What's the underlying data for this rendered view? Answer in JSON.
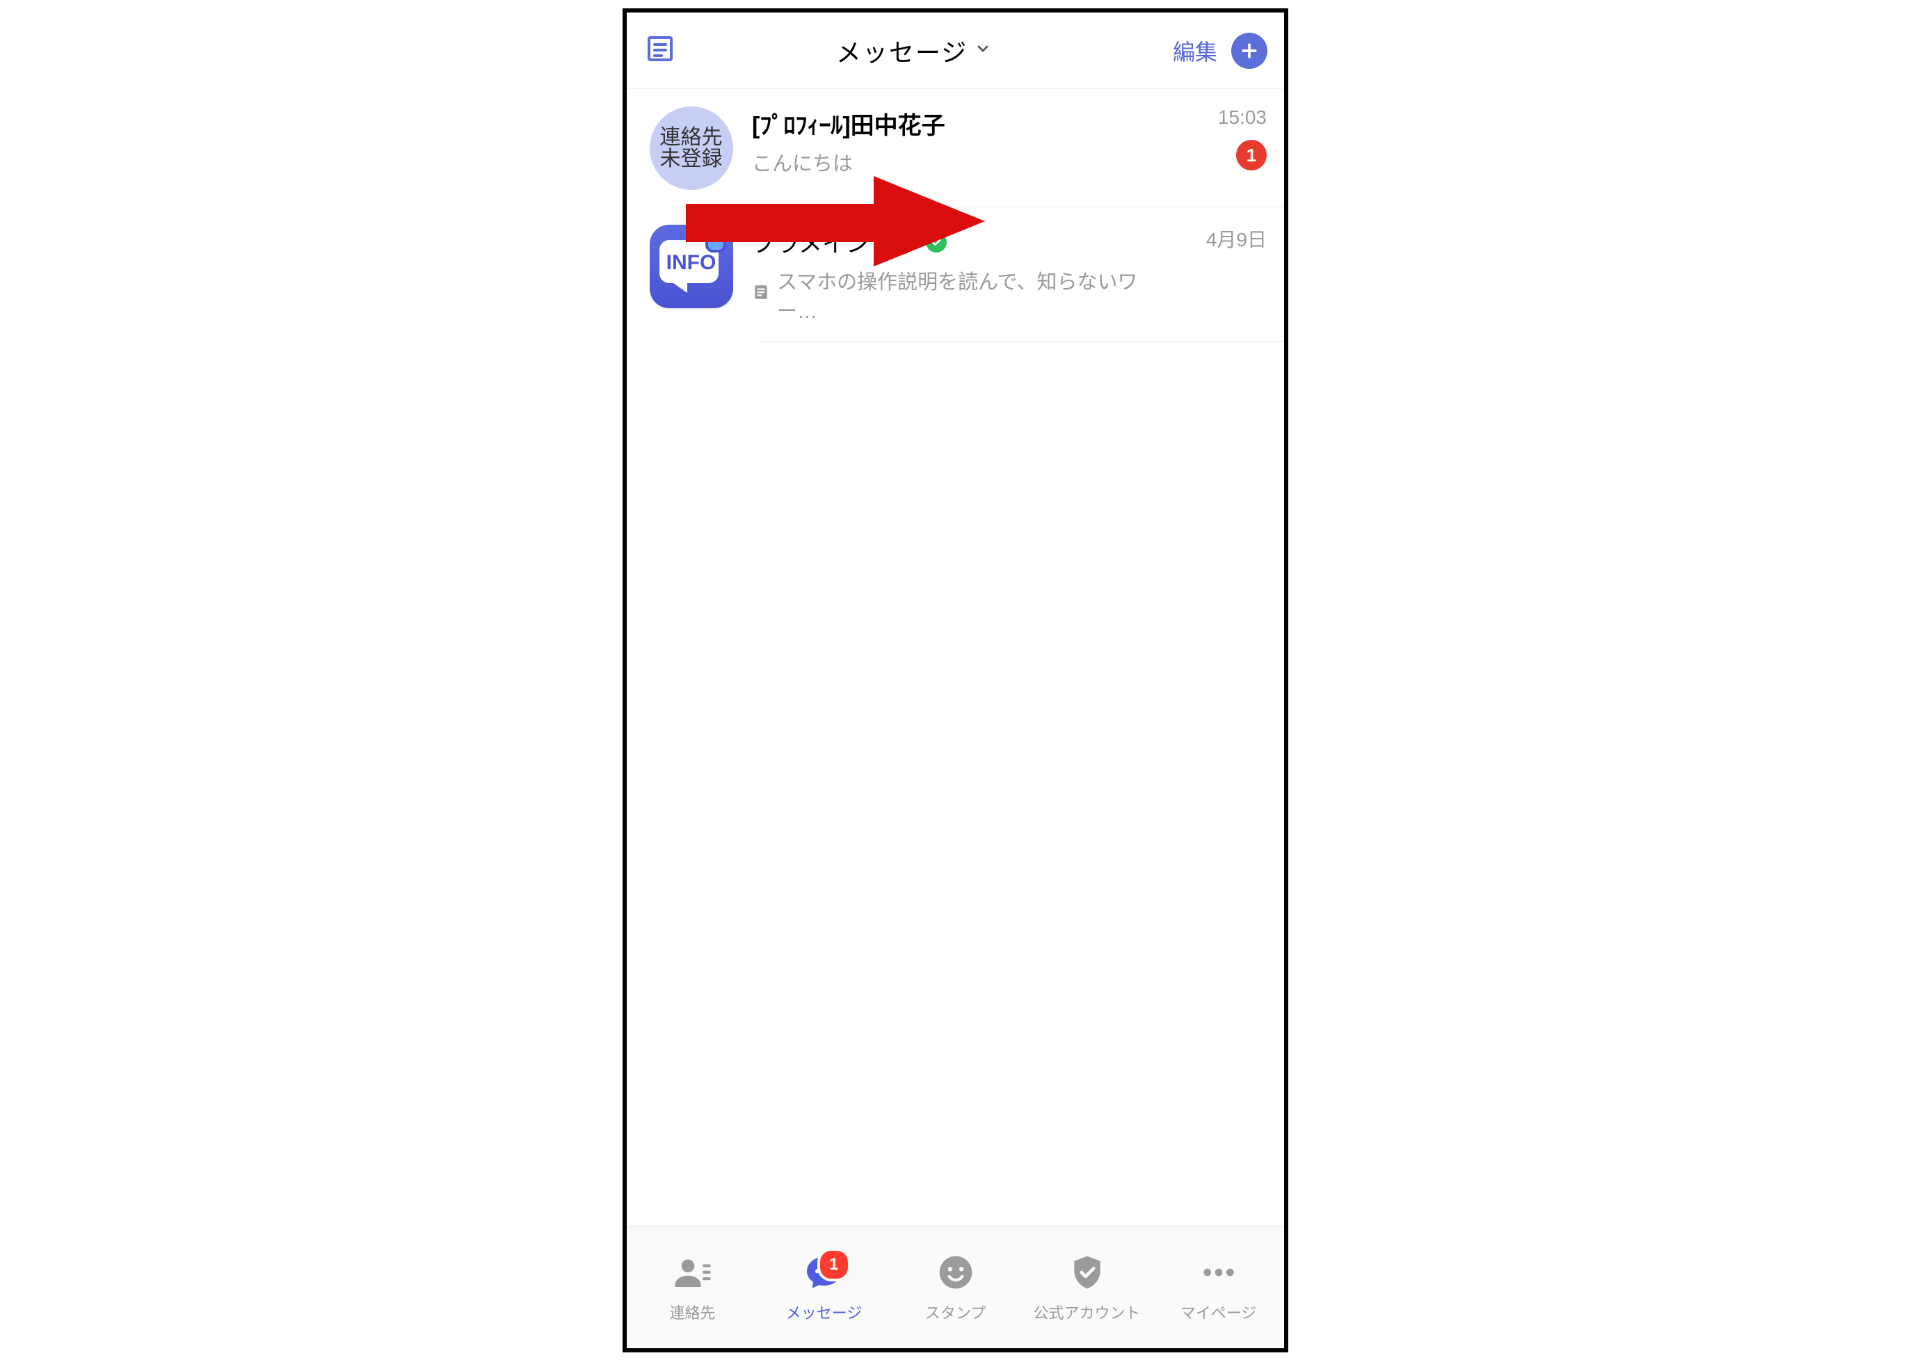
{
  "header": {
    "title": "メッセージ",
    "edit_label": "編集"
  },
  "chats": [
    {
      "avatar_kind": "unregistered",
      "avatar_line1": "連絡先",
      "avatar_line2": "未登録",
      "title": "[ﾌﾟﾛﾌｨｰﾙ]田中花子",
      "preview": "こんにちは",
      "has_preview_icon": false,
      "verified": false,
      "time": "15:03",
      "unread": "1"
    },
    {
      "avatar_kind": "info",
      "avatar_info_label": "INFO",
      "title": "プラメインフォ",
      "preview": "スマホの操作説明を読んで、知らないワー…",
      "has_preview_icon": true,
      "verified": true,
      "time": "4月9日",
      "unread": null
    }
  ],
  "tabs": [
    {
      "label": "連絡先",
      "icon": "contacts",
      "badge": null,
      "active": false
    },
    {
      "label": "メッセージ",
      "icon": "message",
      "badge": "1",
      "active": true
    },
    {
      "label": "スタンプ",
      "icon": "stamp",
      "badge": null,
      "active": false
    },
    {
      "label": "公式アカウント",
      "icon": "official",
      "badge": null,
      "active": false
    },
    {
      "label": "マイページ",
      "icon": "more",
      "badge": null,
      "active": false
    }
  ],
  "annotation": {
    "type": "arrow-right",
    "color": "#d90d0d"
  }
}
